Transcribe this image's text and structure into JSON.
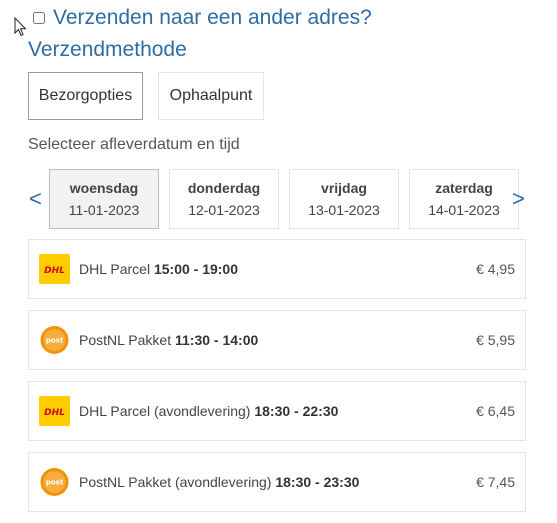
{
  "shipping": {
    "ship_to_other_address_label": "Verzenden naar een ander adres?",
    "checked": false
  },
  "method": {
    "title": "Verzendmethode",
    "tabs": [
      {
        "label": "Bezorgopties",
        "active": true
      },
      {
        "label": "Ophaalpunt",
        "active": false
      }
    ]
  },
  "delivery": {
    "subtitle": "Selecteer afleverdatum en tijd",
    "prev_arrow": "<",
    "next_arrow": ">",
    "days": [
      {
        "name": "woensdag",
        "date": "11-01-2023",
        "active": true
      },
      {
        "name": "donderdag",
        "date": "12-01-2023",
        "active": false
      },
      {
        "name": "vrijdag",
        "date": "13-01-2023",
        "active": false
      },
      {
        "name": "zaterdag",
        "date": "14-01-2023",
        "active": false
      }
    ],
    "options": [
      {
        "carrier": "DHL",
        "logo_icon": "dhl-logo-icon",
        "service": "DHL Parcel",
        "time": "15:00 - 19:00",
        "price": "€ 4,95"
      },
      {
        "carrier": "PostNL",
        "logo_icon": "postnl-logo-icon",
        "service": "PostNL Pakket",
        "time": "11:30 - 14:00",
        "price": "€ 5,95"
      },
      {
        "carrier": "DHL",
        "logo_icon": "dhl-logo-icon",
        "service": "DHL Parcel (avondlevering)",
        "time": "18:30 - 22:30",
        "price": "€ 6,45"
      },
      {
        "carrier": "PostNL",
        "logo_icon": "postnl-logo-icon",
        "service": "PostNL Pakket (avondlevering)",
        "time": "18:30 - 23:30",
        "price": "€ 7,45"
      }
    ]
  },
  "colors": {
    "link_blue": "#2e6da4",
    "dhl_yellow": "#ffcc00",
    "dhl_red": "#d40511",
    "postnl_orange": "#f39200"
  },
  "logo_text": {
    "dhl": "DHL",
    "postnl": "post nl"
  }
}
